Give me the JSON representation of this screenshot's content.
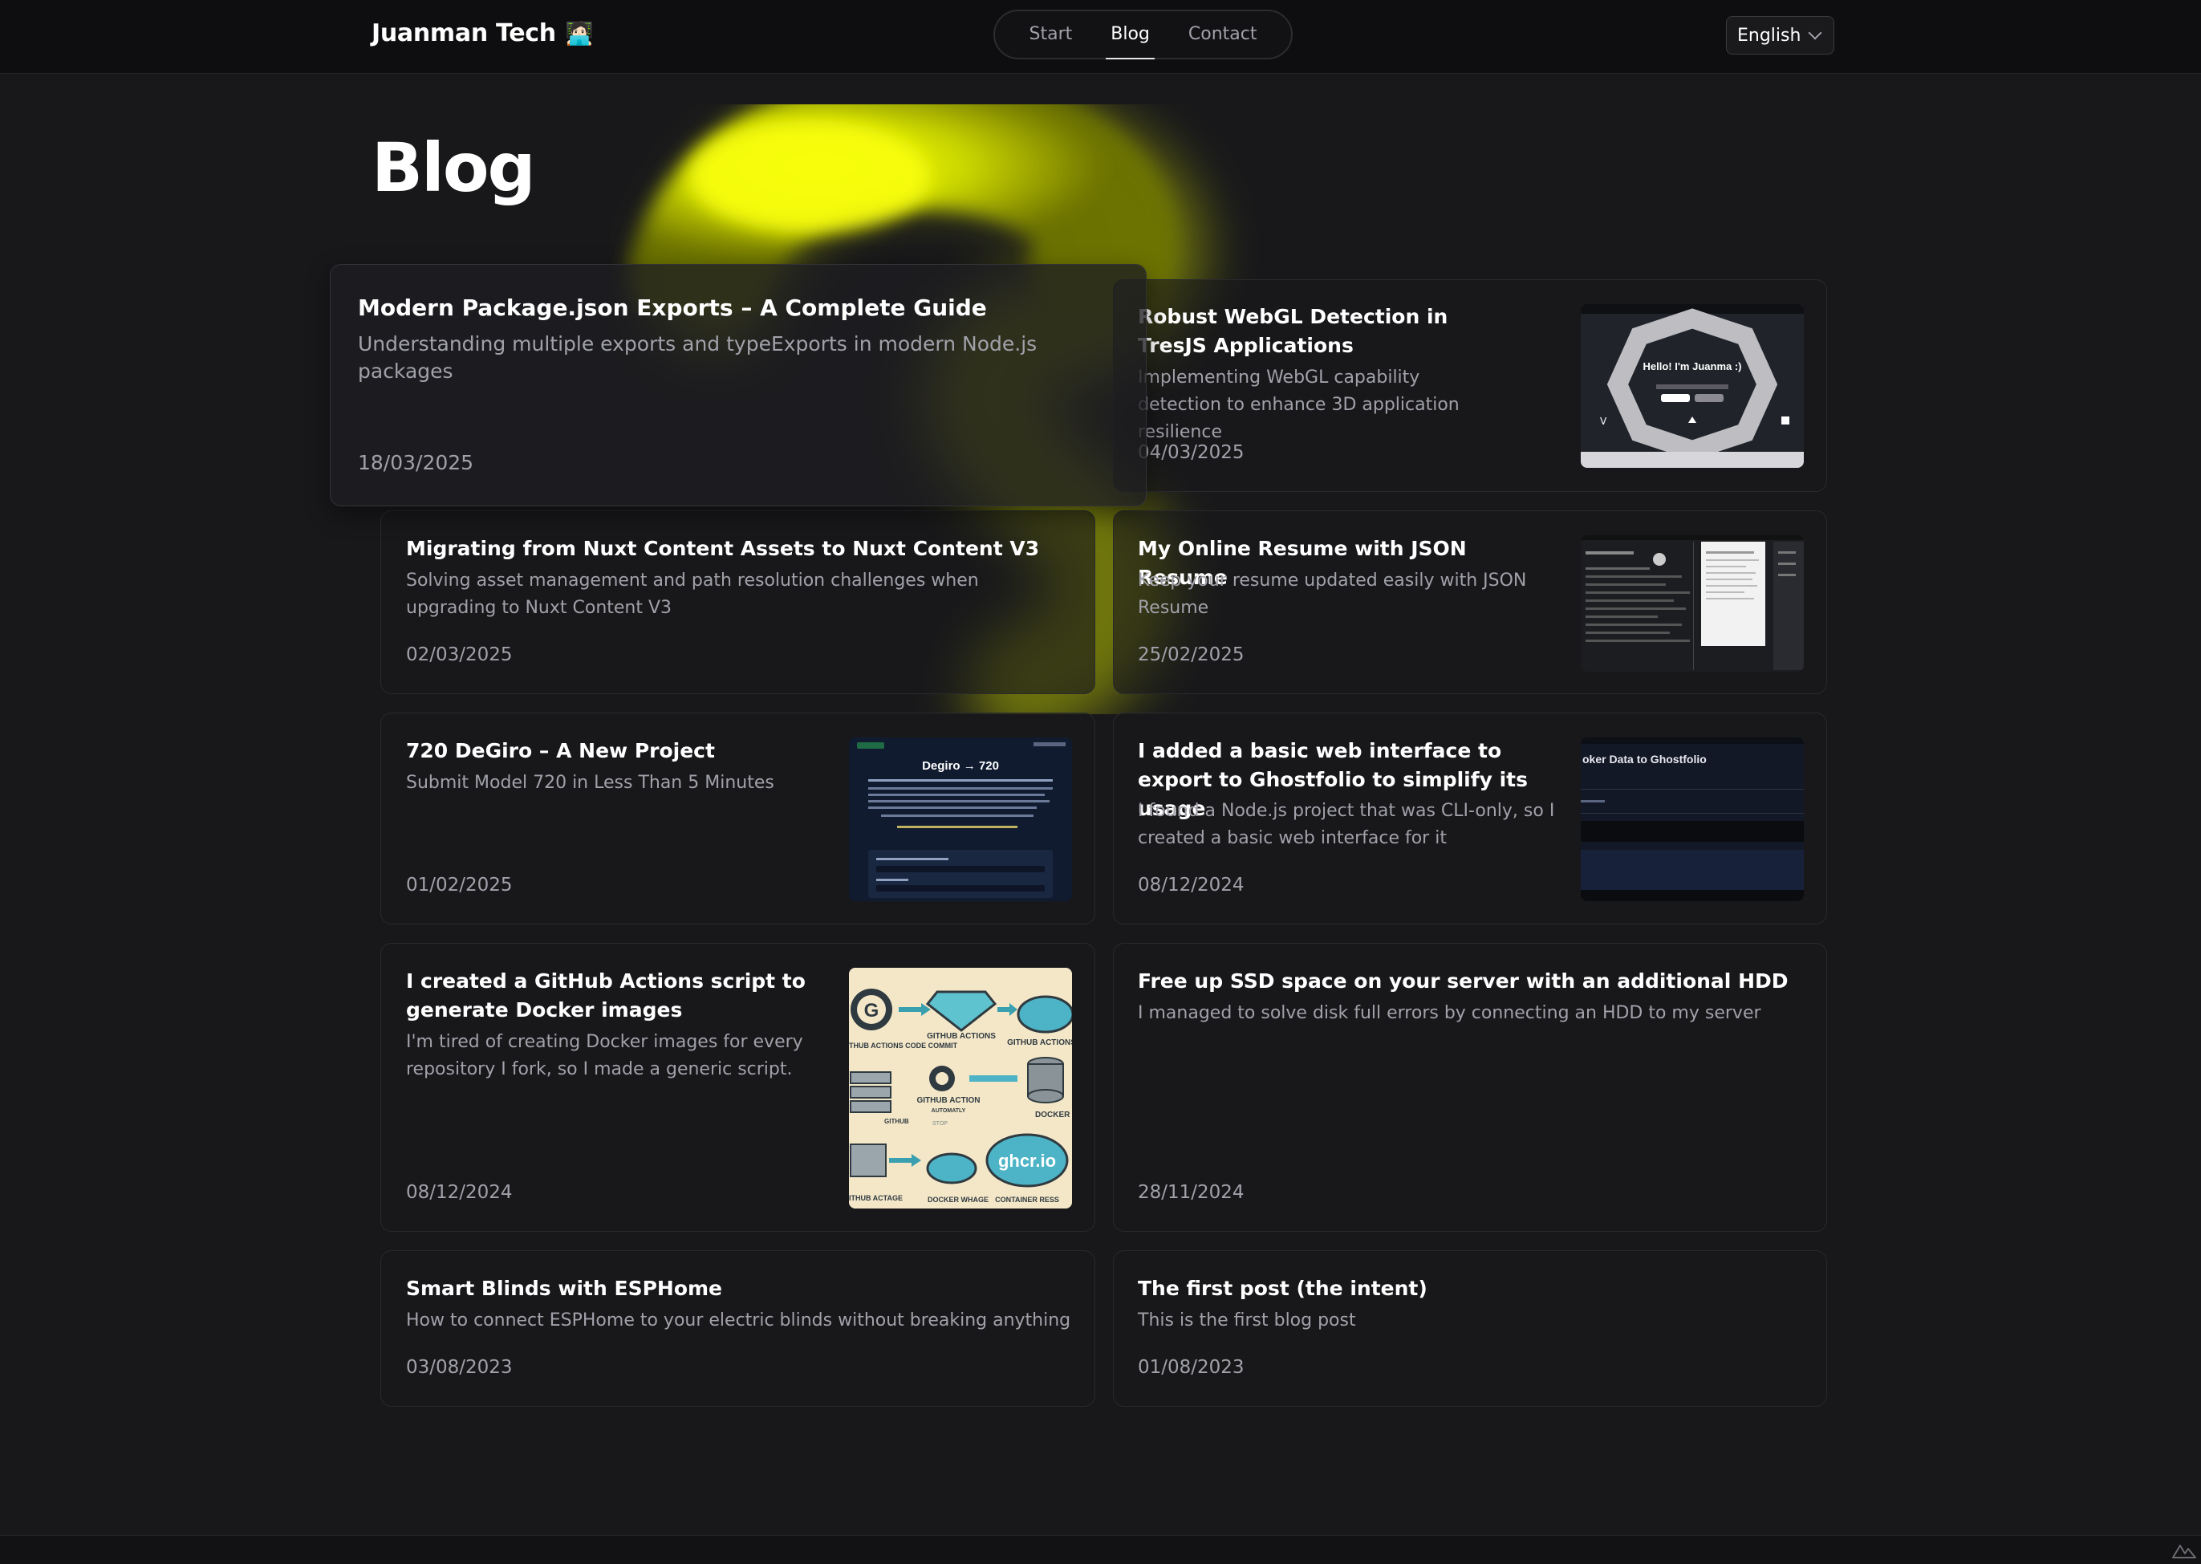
{
  "header": {
    "brand": "Juanman Tech",
    "brand_emoji": "🧑🏻‍💻",
    "nav": [
      {
        "label": "Start"
      },
      {
        "label": "Blog",
        "active": true
      },
      {
        "label": "Contact"
      }
    ],
    "language": "English"
  },
  "page": {
    "title": "Blog"
  },
  "colors": {
    "background": "#18181b",
    "glow": "#e8f000",
    "header": "#0e0e10"
  },
  "posts": [
    {
      "title": "Modern Package.json Exports – A Complete Guide",
      "description": "Understanding multiple exports and typeExports in modern Node.js packages",
      "date": "18/03/2025",
      "featured": true
    },
    {
      "title": "Robust WebGL Detection in TresJS Applications",
      "description": "Implementing WebGL capability detection to enhance 3D application resilience",
      "date": "04/03/2025",
      "thumbnail_text": "Hello! I'm Juanma :)"
    },
    {
      "title": "Migrating from Nuxt Content Assets to Nuxt Content V3",
      "description": "Solving asset management and path resolution challenges when upgrading to Nuxt Content V3",
      "date": "02/03/2025"
    },
    {
      "title": "My Online Resume with JSON Resume",
      "description": "Keep your resume updated easily with JSON Resume",
      "date": "25/02/2025"
    },
    {
      "title": "720 DeGiro – A New Project",
      "description": "Submit Model 720 in Less Than 5 Minutes",
      "date": "01/02/2025",
      "thumbnail_text": "Degiro → 720"
    },
    {
      "title": "I added a basic web interface to export to Ghostfolio to simplify its usage",
      "description": "I found a Node.js project that was CLI-only, so I created a basic web interface for it",
      "date": "08/12/2024",
      "thumbnail_text": "oker Data to Ghostfolio"
    },
    {
      "title": "I created a GitHub Actions script to generate Docker images",
      "description": "I'm tired of creating Docker images for every repository I fork, so I made a generic script.",
      "date": "08/12/2024",
      "thumbnail_labels": [
        "GITHUB ACTIONS",
        "GITHUB ACTIONS",
        "GITHUB ACTION",
        "DOCKER IMAG",
        "ghcr.io",
        "CONTAINER RESS",
        "DOCKER WHAGE",
        "ITHUB ACTAGE",
        "THUB ACTIONS CODE COMMIT",
        "GITHUB",
        "AUTOMATLY",
        "STOP"
      ]
    },
    {
      "title": "Free up SSD space on your server with an additional HDD",
      "description": "I managed to solve disk full errors by connecting an HDD to my server",
      "date": "28/11/2024"
    },
    {
      "title": "Smart Blinds with ESPHome",
      "description": "How to connect ESPHome to your electric blinds without breaking anything",
      "date": "03/08/2023"
    },
    {
      "title": "The first post (the intent)",
      "description": "This is the first blog post",
      "date": "01/08/2023"
    }
  ]
}
